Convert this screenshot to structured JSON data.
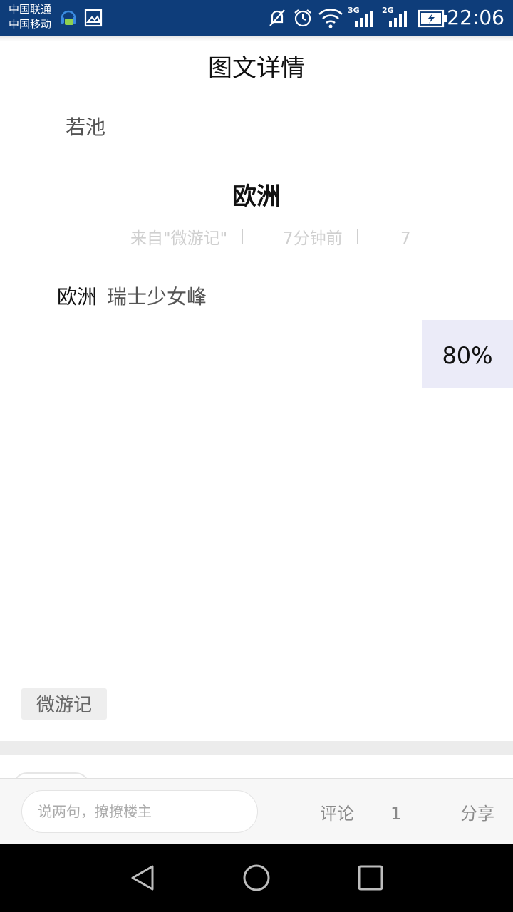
{
  "status_bar": {
    "carrier_1": "中国联通",
    "carrier_2": "中国移动",
    "net_3g": "3G",
    "net_2g": "2G",
    "time": "22:06",
    "icons": [
      "headset-chat-icon",
      "image-icon",
      "mute-icon",
      "alarm-icon",
      "wifi-icon",
      "signal-icon",
      "battery-icon"
    ]
  },
  "header": {
    "title": "图文详情"
  },
  "author": {
    "name": "若池"
  },
  "article": {
    "title": "欧洲",
    "source": "来自\"微游记\"",
    "time_ago": "7分钟前",
    "views": "7",
    "body_tag": "欧洲",
    "body_text": "瑞士少女峰",
    "progress": "80%",
    "topic": "微游记"
  },
  "bottom_bar": {
    "input_placeholder": "说两句，撩撩楼主",
    "comment_label": "评论",
    "comment_count": "1",
    "share_label": "分享"
  },
  "nav_bar": {
    "icons": [
      "back-icon",
      "home-icon",
      "recents-icon"
    ]
  }
}
